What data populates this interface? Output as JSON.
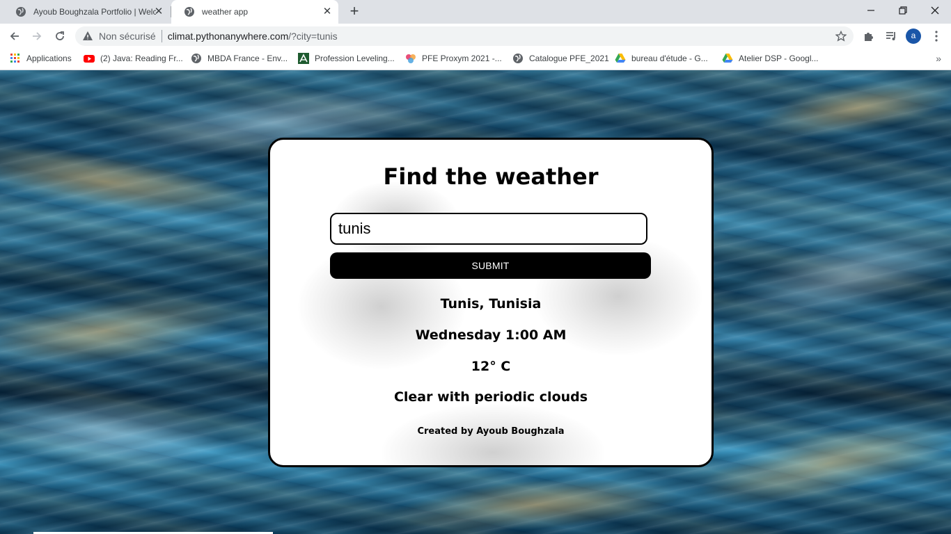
{
  "browser": {
    "tabs": [
      {
        "title": "Ayoub Boughzala Portfolio | Welc",
        "active": false
      },
      {
        "title": "weather app",
        "active": true
      }
    ],
    "address": {
      "security": "Non sécurisé",
      "host": "climat.pythonanywhere.com",
      "path": "/?city=tunis"
    },
    "profile_initial": "a",
    "bookmarks": [
      {
        "label": "Applications",
        "icon": "apps-grid-icon"
      },
      {
        "label": "(2) Java: Reading Fr...",
        "icon": "youtube-icon"
      },
      {
        "label": "MBDA France - Env...",
        "icon": "globe-icon"
      },
      {
        "label": "Profession Leveling...",
        "icon": "leveling-icon"
      },
      {
        "label": "PFE Proxym 2021 -...",
        "icon": "proxym-icon"
      },
      {
        "label": "Catalogue PFE_2021",
        "icon": "globe-icon"
      },
      {
        "label": "bureau d'étude - G...",
        "icon": "google-drive-icon"
      },
      {
        "label": "Atelier DSP - Googl...",
        "icon": "google-drive-icon"
      }
    ],
    "bookmarks_more": "»"
  },
  "app": {
    "heading": "Find the weather",
    "city_value": "tunis",
    "submit_label": "SUBMIT",
    "result": {
      "location": "Tunis, Tunisia",
      "datetime": "Wednesday 1:00 AM",
      "temperature": "12° C",
      "description": "Clear with periodic clouds"
    },
    "credit": "Created by Ayoub Boughzala"
  },
  "colors": {
    "card_bg": "#ffffff",
    "card_border": "#000000",
    "button_bg": "#000000",
    "button_text": "#ffffff",
    "tabstrip_bg": "#dee1e6",
    "avatar_bg": "#1a56a8"
  }
}
